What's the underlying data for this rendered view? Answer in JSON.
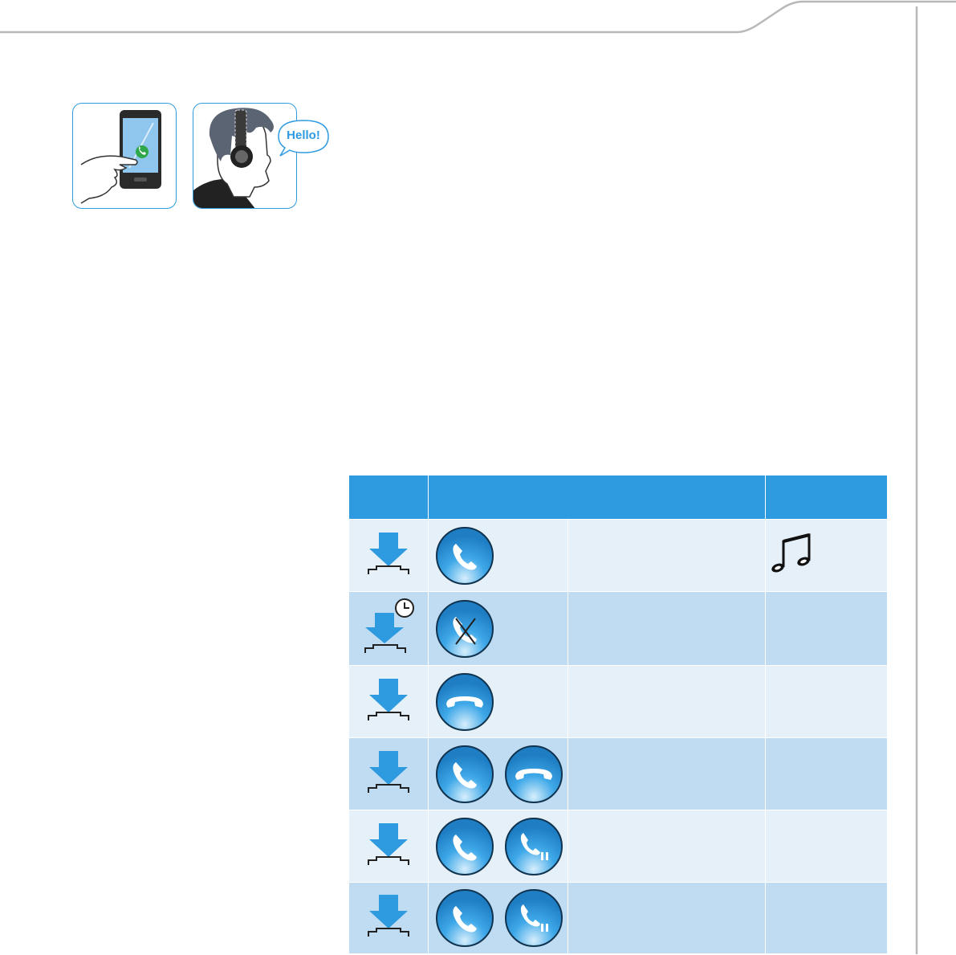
{
  "page": {
    "colors": {
      "accent": "#2e9be0",
      "row_light": "#e6f0f8",
      "row_dark": "#c0dcf2",
      "rule": "#b8b8b8"
    }
  },
  "illustrations": {
    "phone": {
      "icon": "phone-answer-icon"
    },
    "headset": {
      "icon": "headset-user-icon",
      "speech": "Hello!"
    }
  },
  "table": {
    "headers": [
      "",
      "",
      ""
    ],
    "rows": [
      {
        "press": "press-icon",
        "icons": [
          "call-accept-icon"
        ],
        "description": "",
        "signal": "music-notes-icon"
      },
      {
        "press": "press-hold-icon",
        "icons": [
          "call-reject-icon"
        ],
        "description": "",
        "signal": ""
      },
      {
        "press": "press-icon",
        "icons": [
          "call-end-icon"
        ],
        "description": "",
        "signal": ""
      },
      {
        "press": "press-icon",
        "icons": [
          "call-accept-icon",
          "call-end-icon"
        ],
        "description": "",
        "signal": ""
      },
      {
        "press": "press-icon",
        "icons": [
          "call-accept-icon",
          "call-hold-icon"
        ],
        "description": "",
        "signal": ""
      },
      {
        "press": "press-icon",
        "icons": [
          "call-accept-icon",
          "call-hold-icon"
        ],
        "description": "",
        "signal": ""
      }
    ]
  }
}
